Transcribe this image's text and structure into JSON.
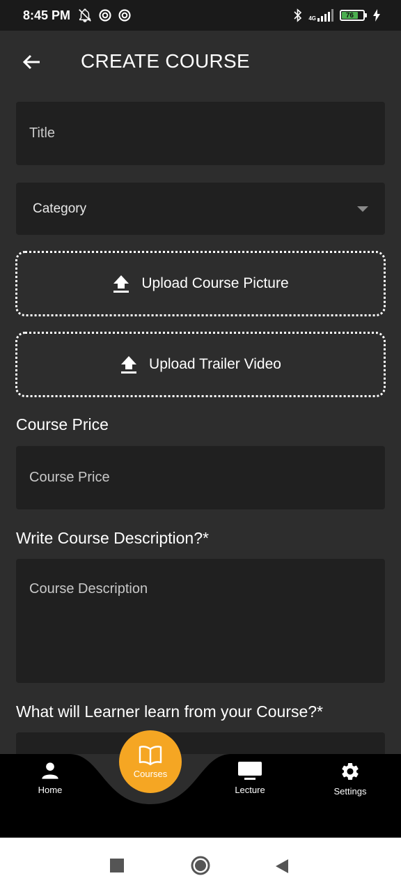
{
  "status_bar": {
    "time": "8:45 PM",
    "network": "4G",
    "battery": "76",
    "icons": [
      "notifications-off-icon",
      "data-saver-icon",
      "data-saver-icon",
      "bluetooth-icon",
      "signal-icon",
      "battery-icon",
      "charging-icon"
    ]
  },
  "header": {
    "title": "CREATE COURSE",
    "back_icon": "arrow-left-icon"
  },
  "form": {
    "title_placeholder": "Title",
    "category_label": "Category",
    "upload_picture_label": "Upload Course Picture",
    "upload_video_label": "Upload Trailer Video",
    "price_section_label": "Course Price",
    "price_placeholder": "Course Price",
    "description_section_label": "Write Course Description?*",
    "description_placeholder": "Course Description",
    "learn_section_label": "What will Learner learn from your Course?*"
  },
  "bottom_nav": {
    "items": [
      {
        "label": "Home",
        "icon": "person-icon"
      },
      {
        "label": "Courses",
        "icon": "book-icon"
      },
      {
        "label": "Lecture",
        "icon": "monitor-icon"
      },
      {
        "label": "Settings",
        "icon": "gear-icon"
      }
    ],
    "active_color": "#f5a623"
  },
  "colors": {
    "background": "#2d2d2d",
    "field": "#202020",
    "accent": "#f5a623"
  }
}
